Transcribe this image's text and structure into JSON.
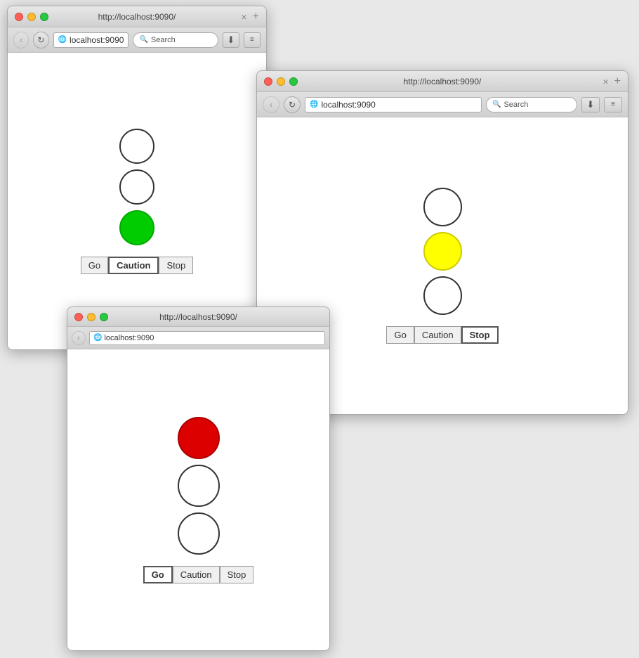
{
  "browser1": {
    "title": "http://localhost:9090/",
    "url": "localhost:9090",
    "search_placeholder": "Search",
    "tab_label": "http://localhost:9090/",
    "state": "go",
    "lights": [
      "off",
      "off",
      "green"
    ],
    "buttons": [
      "Go",
      "Caution",
      "Stop"
    ]
  },
  "browser2": {
    "title": "http://localhost:9090/",
    "url": "localhost:9090",
    "search_placeholder": "Search",
    "tab_label": "http://localhost:9090/",
    "state": "caution",
    "lights": [
      "off",
      "yellow",
      "off"
    ],
    "buttons": [
      "Go",
      "Caution",
      "Stop"
    ]
  },
  "browser3": {
    "title": "http://localhost:9090/",
    "url": "localhost:9090",
    "state": "stop",
    "lights": [
      "red",
      "off",
      "off"
    ],
    "buttons": [
      "Go",
      "Caution",
      "Stop"
    ]
  },
  "colors": {
    "green": "#00cc00",
    "yellow": "#ffff00",
    "red": "#dd0000",
    "off": "#ffffff",
    "accent": "#555555"
  }
}
